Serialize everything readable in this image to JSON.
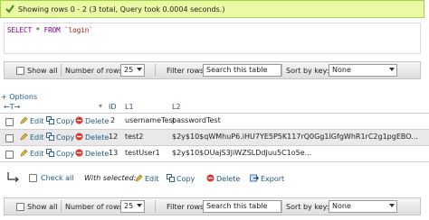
{
  "banner": {
    "message": "Showing rows 0 - 2 (3 total, Query took 0.0004 seconds.)"
  },
  "sql": {
    "kw1": "SELECT",
    "star": "*",
    "kw2": "FROM",
    "table": "`login`"
  },
  "nav": {
    "show_all": "Show all",
    "num_rows_label": "Number of rows:",
    "num_rows_value": "25",
    "filter_label": "Filter rows:",
    "filter_placeholder": "Search this table",
    "sort_label": "Sort by key:",
    "sort_value": "None"
  },
  "options_link": "+ Options",
  "table": {
    "arrows": "←T→",
    "columns": [
      "ID",
      "L1",
      "L2"
    ],
    "actions": {
      "edit": "Edit",
      "copy": "Copy",
      "delete": "Delete"
    },
    "rows": [
      {
        "id": "2",
        "l1": "usernameTest",
        "l2": "passwordTest"
      },
      {
        "id": "12",
        "l1": "test2",
        "l2": "$2y$10$qWMhuP6.iHU7YE5P5K117rQ0Gg1IGfgWhR1rC2g1pgEBO..."
      },
      {
        "id": "13",
        "l1": "testUser1",
        "l2": "$2y$10$OUajS3JiWZSLDdJuu5C1o5e..."
      }
    ]
  },
  "bulk": {
    "check_all": "Check all",
    "with_selected": "With selected:",
    "edit": "Edit",
    "copy": "Copy",
    "delete": "Delete",
    "export": "Export"
  }
}
